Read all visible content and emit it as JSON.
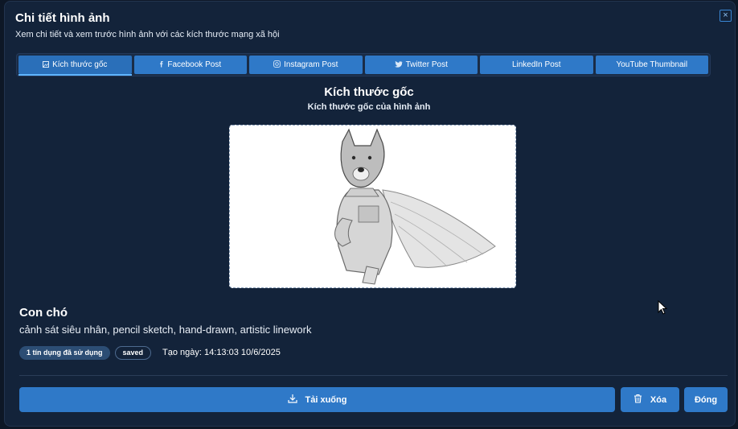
{
  "dialog": {
    "title": "Chi tiết hình ảnh",
    "subtitle": "Xem chi tiết và xem trước hình ảnh với các kích thước mạng xã hội"
  },
  "tabs": [
    {
      "label": "Kích thước gốc",
      "icon": "image-icon",
      "active": true
    },
    {
      "label": "Facebook Post",
      "icon": "facebook-icon",
      "active": false
    },
    {
      "label": "Instagram Post",
      "icon": "instagram-icon",
      "active": false
    },
    {
      "label": "Twitter Post",
      "icon": "twitter-icon",
      "active": false
    },
    {
      "label": "LinkedIn Post",
      "icon": "",
      "active": false
    },
    {
      "label": "YouTube Thumbnail",
      "icon": "",
      "active": false
    }
  ],
  "preview": {
    "title": "Kích thước gốc",
    "subtitle": "Kích thước gốc của hình ảnh"
  },
  "image": {
    "name": "Con chó",
    "prompt": "cảnh sát siêu nhân, pencil sketch, hand-drawn, artistic linework",
    "credit_badge": "1 tín dụng đã sử dụng",
    "status_badge": "saved",
    "created": "Tạo ngày: 14:13:03 10/6/2025"
  },
  "actions": {
    "download": "Tải xuống",
    "delete": "Xóa",
    "close": "Đóng"
  },
  "colors": {
    "modal_bg": "#13233a",
    "accent": "#2f79c8",
    "tab_indicator": "#5fb4ff"
  }
}
